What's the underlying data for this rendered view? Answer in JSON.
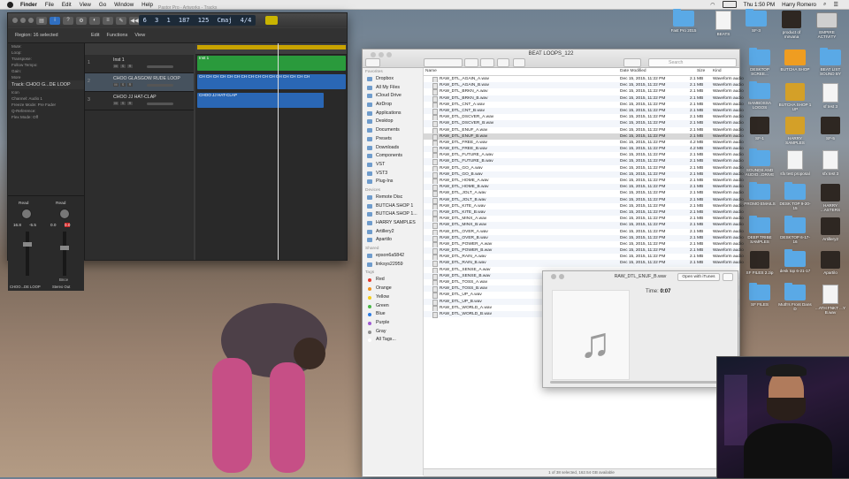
{
  "menubar": {
    "app": "Finder",
    "items": [
      "File",
      "Edit",
      "View",
      "Go",
      "Window",
      "Help"
    ],
    "clock": "Thu 1:50 PM",
    "user": "Harry Romero"
  },
  "logic": {
    "window_title": "Pastor Pro - Artworks - Tracks",
    "lcd": {
      "bar": "6",
      "beat": "3",
      "sub": "1",
      "tempo": "125",
      "key": "Cmaj",
      "sig": "4/4",
      "pos": "187"
    },
    "toolbar": {
      "edit": "Edit",
      "functions": "Functions",
      "view": "View"
    },
    "region_info": "Region: 16 selected",
    "inspector_rows": [
      "Mute:",
      "Loop:",
      "Transpose:",
      "Follow Tempo:",
      "Gain:",
      "More"
    ],
    "track_header": "Track: CHOO G...DE LOOP",
    "channel_rows": [
      "Icon",
      "Channel: Audio 1",
      "Freeze Mode: Pre Fader",
      "Q-Reference:",
      "Flex Mode: Off"
    ],
    "tracks": [
      {
        "num": "1",
        "name": "Inst 1"
      },
      {
        "num": "2",
        "name": "CHOO GLASGOW RUDE LOOP"
      },
      {
        "num": "3",
        "name": "CHOO JJ HAT-CLAP"
      }
    ],
    "regions": {
      "green": "Inst 1",
      "blue_loop": "CH CH CH CH CH CH CH CH CH CH CH CH CH CH CH CH",
      "blue_hat": "CHOO JJ HAT-CLAP"
    },
    "mixer": {
      "read1": "Read",
      "read2": "Read",
      "v1": "16.8",
      "v2": "-5.5",
      "v3": "0.0",
      "v4": "0.0",
      "bounce": "Bnce",
      "out1": "CHOO...DE LOOP",
      "out2": "Stereo Out"
    }
  },
  "finder": {
    "title": "BEAT LOOPS_122",
    "search_placeholder": "Search",
    "sidebar": {
      "favorites_label": "Favorites",
      "favorites": [
        "Dropbox",
        "All My Files",
        "iCloud Drive",
        "AirDrop",
        "Applications",
        "Desktop",
        "Documents",
        "Presets",
        "Downloads",
        "Components",
        "VST",
        "VST3",
        "Plug-Ins"
      ],
      "devices_label": "Devices",
      "devices": [
        "Remote Disc",
        "BUTCHA SHOP 1",
        "BUTCHA SHOP 1...",
        "HARRY SAMPLES",
        "Artillery2",
        "Apartilo"
      ],
      "shared_label": "Shared",
      "shared": [
        "epson6a5842",
        "linksys22959"
      ],
      "tags_label": "Tags",
      "tags": [
        {
          "name": "Red",
          "color": "#e33b2e"
        },
        {
          "name": "Orange",
          "color": "#f0931f"
        },
        {
          "name": "Yellow",
          "color": "#f4cd1c"
        },
        {
          "name": "Green",
          "color": "#49b746"
        },
        {
          "name": "Blue",
          "color": "#2f7de1"
        },
        {
          "name": "Purple",
          "color": "#9f5bd0"
        },
        {
          "name": "Gray",
          "color": "#8f8f8f"
        },
        {
          "name": "All Tags...",
          "color": "#ffffff"
        }
      ]
    },
    "columns": {
      "name": "Name",
      "date": "Date Modified",
      "size": "Size",
      "kind": "Kind"
    },
    "files": [
      {
        "name": "RAW_DTL_AGAIN_A.wav",
        "date": "Dec 15, 2015, 11:22 PM",
        "size": "2.1 MB",
        "kind": "Waveform audio"
      },
      {
        "name": "RAW_DTL_AGAIN_B.wav",
        "date": "Dec 15, 2015, 11:22 PM",
        "size": "2.1 MB",
        "kind": "Waveform audio"
      },
      {
        "name": "RAW_DTL_BRKN_A.wav",
        "date": "Dec 15, 2015, 11:22 PM",
        "size": "2.1 MB",
        "kind": "Waveform audio"
      },
      {
        "name": "RAW_DTL_BRKN_B.wav",
        "date": "Dec 15, 2015, 11:22 PM",
        "size": "2.1 MB",
        "kind": "Waveform audio"
      },
      {
        "name": "RAW_DTL_CNT_A.wav",
        "date": "Dec 15, 2015, 11:22 PM",
        "size": "2.1 MB",
        "kind": "Waveform audio"
      },
      {
        "name": "RAW_DTL_CNT_B.wav",
        "date": "Dec 15, 2015, 11:22 PM",
        "size": "2.1 MB",
        "kind": "Waveform audio"
      },
      {
        "name": "RAW_DTL_DSCVER_A.wav",
        "date": "Dec 15, 2015, 11:22 PM",
        "size": "2.1 MB",
        "kind": "Waveform audio"
      },
      {
        "name": "RAW_DTL_DSCVER_B.wav",
        "date": "Dec 15, 2015, 11:22 PM",
        "size": "2.1 MB",
        "kind": "Waveform audio"
      },
      {
        "name": "RAW_DTL_ENUF_A.wav",
        "date": "Dec 15, 2015, 11:22 PM",
        "size": "2.1 MB",
        "kind": "Waveform audio"
      },
      {
        "name": "RAW_DTL_ENUF_B.wav",
        "date": "Dec 15, 2015, 11:22 PM",
        "size": "2.1 MB",
        "kind": "Waveform audio"
      },
      {
        "name": "RAW_DTL_FREE_A.wav",
        "date": "Dec 15, 2015, 11:22 PM",
        "size": "4.2 MB",
        "kind": "Waveform audio"
      },
      {
        "name": "RAW_DTL_FREE_B.wav",
        "date": "Dec 15, 2015, 11:22 PM",
        "size": "4.2 MB",
        "kind": "Waveform audio"
      },
      {
        "name": "RAW_DTL_FUTURE_A.wav",
        "date": "Dec 15, 2015, 11:22 PM",
        "size": "2.1 MB",
        "kind": "Waveform audio"
      },
      {
        "name": "RAW_DTL_FUTURE_B.wav",
        "date": "Dec 15, 2015, 11:22 PM",
        "size": "2.1 MB",
        "kind": "Waveform audio"
      },
      {
        "name": "RAW_DTL_GO_A.wav",
        "date": "Dec 15, 2015, 11:22 PM",
        "size": "2.1 MB",
        "kind": "Waveform audio"
      },
      {
        "name": "RAW_DTL_GO_B.wav",
        "date": "Dec 15, 2015, 11:22 PM",
        "size": "2.1 MB",
        "kind": "Waveform audio"
      },
      {
        "name": "RAW_DTL_HOME_A.wav",
        "date": "Dec 15, 2015, 11:22 PM",
        "size": "2.1 MB",
        "kind": "Waveform audio"
      },
      {
        "name": "RAW_DTL_HOME_B.wav",
        "date": "Dec 15, 2015, 11:22 PM",
        "size": "2.1 MB",
        "kind": "Waveform audio"
      },
      {
        "name": "RAW_DTL_JOLT_A.wav",
        "date": "Dec 15, 2015, 11:22 PM",
        "size": "2.1 MB",
        "kind": "Waveform audio"
      },
      {
        "name": "RAW_DTL_JOLT_B.wav",
        "date": "Dec 15, 2015, 11:22 PM",
        "size": "2.1 MB",
        "kind": "Waveform audio"
      },
      {
        "name": "RAW_DTL_KITE_A.wav",
        "date": "Dec 15, 2015, 11:22 PM",
        "size": "2.1 MB",
        "kind": "Waveform audio"
      },
      {
        "name": "RAW_DTL_KITE_B.wav",
        "date": "Dec 15, 2015, 11:22 PM",
        "size": "2.1 MB",
        "kind": "Waveform audio"
      },
      {
        "name": "RAW_DTL_MINX_A.wav",
        "date": "Dec 15, 2015, 11:22 PM",
        "size": "2.1 MB",
        "kind": "Waveform audio"
      },
      {
        "name": "RAW_DTL_MINX_B.wav",
        "date": "Dec 15, 2015, 11:22 PM",
        "size": "2.1 MB",
        "kind": "Waveform audio"
      },
      {
        "name": "RAW_DTL_OVER_A.wav",
        "date": "Dec 15, 2015, 11:22 PM",
        "size": "2.1 MB",
        "kind": "Waveform audio"
      },
      {
        "name": "RAW_DTL_OVER_B.wav",
        "date": "Dec 15, 2015, 11:22 PM",
        "size": "2.1 MB",
        "kind": "Waveform audio"
      },
      {
        "name": "RAW_DTL_POWER_A.wav",
        "date": "Dec 15, 2015, 11:22 PM",
        "size": "2.1 MB",
        "kind": "Waveform audio"
      },
      {
        "name": "RAW_DTL_POWER_B.wav",
        "date": "Dec 15, 2015, 11:22 PM",
        "size": "2.1 MB",
        "kind": "Waveform audio"
      },
      {
        "name": "RAW_DTL_RAIN_A.wav",
        "date": "Dec 15, 2015, 11:22 PM",
        "size": "2.1 MB",
        "kind": "Waveform audio"
      },
      {
        "name": "RAW_DTL_RAIN_B.wav",
        "date": "Dec 15, 2015, 11:22 PM",
        "size": "2.1 MB",
        "kind": "Waveform audio"
      },
      {
        "name": "RAW_DTL_SENSE_A.wav",
        "date": "",
        "size": "",
        "kind": ""
      },
      {
        "name": "RAW_DTL_SENSE_B.wav",
        "date": "",
        "size": "",
        "kind": ""
      },
      {
        "name": "RAW_DTL_TOSS_A.wav",
        "date": "",
        "size": "",
        "kind": ""
      },
      {
        "name": "RAW_DTL_TOSS_B.wav",
        "date": "",
        "size": "",
        "kind": ""
      },
      {
        "name": "RAW_DTL_UP_A.wav",
        "date": "",
        "size": "",
        "kind": ""
      },
      {
        "name": "RAW_DTL_UP_B.wav",
        "date": "",
        "size": "",
        "kind": ""
      },
      {
        "name": "RAW_DTL_WORLD_A.wav",
        "date": "",
        "size": "",
        "kind": ""
      },
      {
        "name": "RAW_DTL_WORLD_B.wav",
        "date": "",
        "size": "",
        "kind": ""
      }
    ],
    "selected_index": 9,
    "status": "1 of 38 selected, 162.54 GB available"
  },
  "quicklook": {
    "title": "RAW_DTL_ENUF_B.wav",
    "open_with": "Open with iTunes",
    "time_label": "Time:",
    "time_value": "0:07"
  },
  "desktop": [
    {
      "label": "Fast Pro 2015",
      "kind": "fold"
    },
    {
      "label": "BEATS",
      "kind": "doc"
    },
    {
      "label": "SF-3",
      "kind": "fold"
    },
    {
      "label": "product of mirvana",
      "kind": "dark"
    },
    {
      "label": "EMPIRE ACTIVITY",
      "kind": "drive"
    },
    {
      "label": "BEAT LIST SOUND BY",
      "kind": "fold"
    },
    {
      "label": "DESKTOP SCREE...",
      "kind": "fold"
    },
    {
      "label": "BUTCHA SHOP",
      "kind": "orange"
    },
    {
      "label": "sf test 3",
      "kind": "doc"
    },
    {
      "label": "BAMBOSSA LOGOS",
      "kind": "fold"
    },
    {
      "label": "BUTCHA SHOP 1 UP",
      "kind": "gold"
    },
    {
      "label": "SF-5",
      "kind": "dark"
    },
    {
      "label": "SF-1",
      "kind": "dark"
    },
    {
      "label": "HARRY SAMPLES",
      "kind": "gold"
    },
    {
      "label": "sfx test 3",
      "kind": "doc"
    },
    {
      "label": "SOUNDS AND AUDIO...DRIVE",
      "kind": "fold"
    },
    {
      "label": "sfx test proposal",
      "kind": "doc"
    },
    {
      "label": "HARRY ...ASTERS",
      "kind": "dark"
    },
    {
      "label": "PROMO EMAILS",
      "kind": "fold"
    },
    {
      "label": "DESK TOP 9-20-15",
      "kind": "fold"
    },
    {
      "label": "Artillery2",
      "kind": "dark"
    },
    {
      "label": "DEEP TRIBE SAMPLES",
      "kind": "fold"
    },
    {
      "label": "DESKTOP 6-17-16",
      "kind": "fold"
    },
    {
      "label": "Apartilo",
      "kind": "dark"
    },
    {
      "label": "SF FILES 2.zip",
      "kind": "dark"
    },
    {
      "label": "desk top 6-21-17",
      "kind": "fold"
    },
    {
      "label": "...ATH FNKT ...Y B.wav",
      "kind": "doc"
    },
    {
      "label": "SF FILES",
      "kind": "fold"
    },
    {
      "label": "Muth's Front Dans D",
      "kind": "fold"
    }
  ]
}
